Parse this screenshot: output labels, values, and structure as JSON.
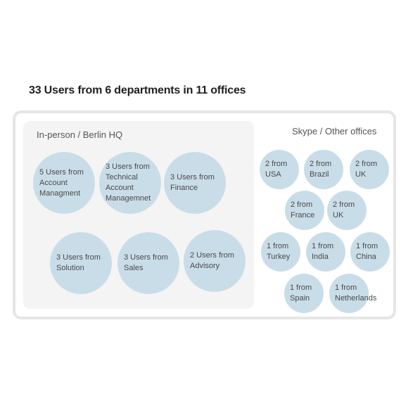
{
  "title": "33 Users from 6 departments in 11 offices",
  "inperson": {
    "label": "In-person / Berlin HQ",
    "items": [
      "5 Users from\nAccount\nManagment",
      "3 Users from\nTechnical\nAccount\nManagemnet",
      "3 Users from\nFinance",
      "3 Users from\nSolution",
      "3 Users from\nSales",
      "2 Users from\nAdvisory"
    ]
  },
  "remote": {
    "label": "Skype / Other offices",
    "items": [
      "2 from\nUSA",
      "2 from\nBrazil",
      "2 from\nUK",
      "2 from\nFrance",
      "2 from\nUK",
      "1 from\nTurkey",
      "1 from\nIndia",
      "1 from\nChina",
      "1 from\nSpain",
      "1 from\nNetherlands"
    ]
  },
  "colors": {
    "bubble": "#c9dde8",
    "panel": "#f4f4f4",
    "border": "#e6e6e6"
  }
}
